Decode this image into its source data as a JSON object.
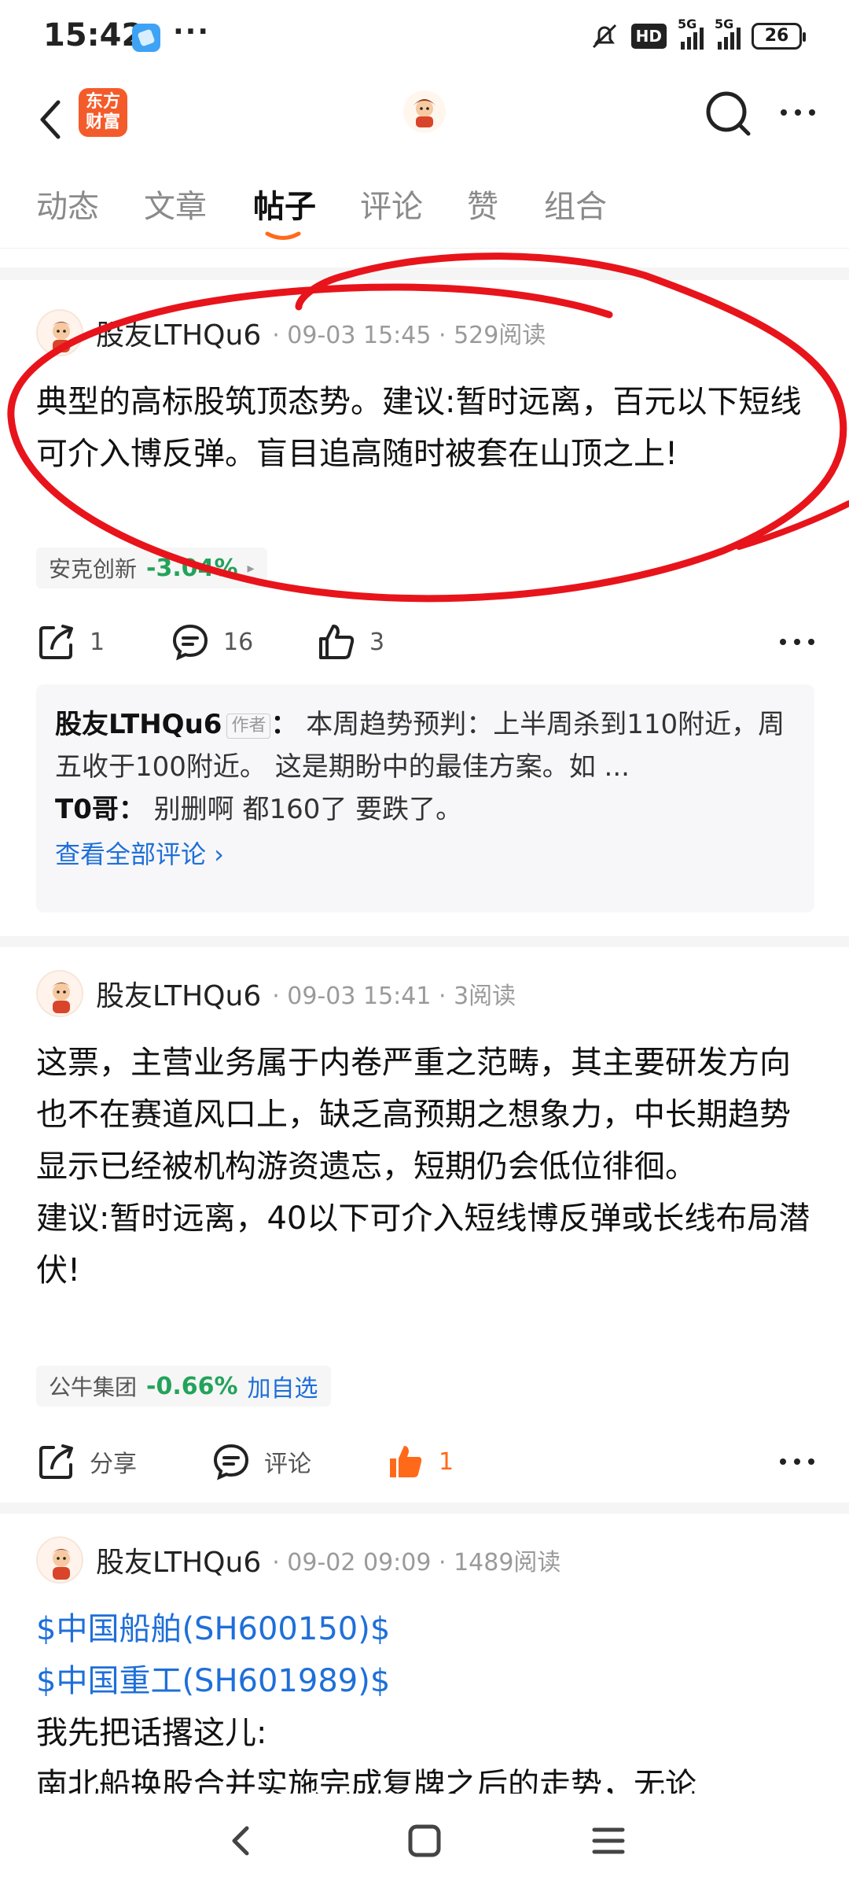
{
  "status_bar": {
    "time": "15:42",
    "more": "···",
    "network_1": "5G",
    "network_2": "5G",
    "hd": "HD",
    "battery": "26"
  },
  "header": {
    "logo_text_1": "东方",
    "logo_text_2": "财富"
  },
  "tabs": [
    {
      "label": "动态"
    },
    {
      "label": "文章"
    },
    {
      "label": "帖子"
    },
    {
      "label": "评论"
    },
    {
      "label": "赞"
    },
    {
      "label": "组合"
    }
  ],
  "posts": [
    {
      "user": "股友LTHQu6",
      "meta": "· 09-03 15:45 · 529阅读",
      "body": "典型的高标股筑顶态势。建议:暂时远离，百元以下短线可介入博反弹。盲目追高随时被套在山顶之上!",
      "stock": {
        "name": "安克创新",
        "change": "-3.04%",
        "arrow": "▸"
      },
      "actions": {
        "share": "1",
        "comment": "16",
        "like": "3"
      },
      "comments": [
        {
          "author": "股友LTHQu6",
          "badge": "作者",
          "text": "本周趋势预判：上半周杀到110附近，周五收于100附近。 这是期盼中的最佳方案。如 ..."
        },
        {
          "author": "T0哥",
          "badge": "",
          "text": "别删啊 都160了 要跌了。"
        }
      ],
      "view_all": "查看全部评论 ›"
    },
    {
      "user": "股友LTHQu6",
      "meta": "· 09-03 15:41 · 3阅读",
      "body_1": "这票，主营业务属于内卷严重之范畴，其主要研发方向也不在赛道风口上，缺乏高预期之想象力，中长期趋势显示已经被机构游资遗忘，短期仍会低位徘徊。",
      "body_2": "建议:暂时远离，40以下可介入短线博反弹或长线布局潜伏!",
      "stock": {
        "name": "公牛集团",
        "change": "-0.66%",
        "add": "加自选"
      },
      "actions": {
        "share": "分享",
        "comment": "评论",
        "like": "1"
      }
    },
    {
      "user": "股友LTHQu6",
      "meta": "· 09-02 09:09 · 1489阅读",
      "link_1": "$中国船舶(SH600150)$",
      "link_2": "$中国重工(SH601989)$",
      "line_3": "我先把话撂这儿:",
      "line_4": "南北船换股合并实施完成复牌之后的走势，无论"
    }
  ],
  "colors": {
    "accent": "#ff6a1a",
    "link": "#1e6fd9",
    "down": "#23a35a",
    "annotation": "#e8141b"
  }
}
